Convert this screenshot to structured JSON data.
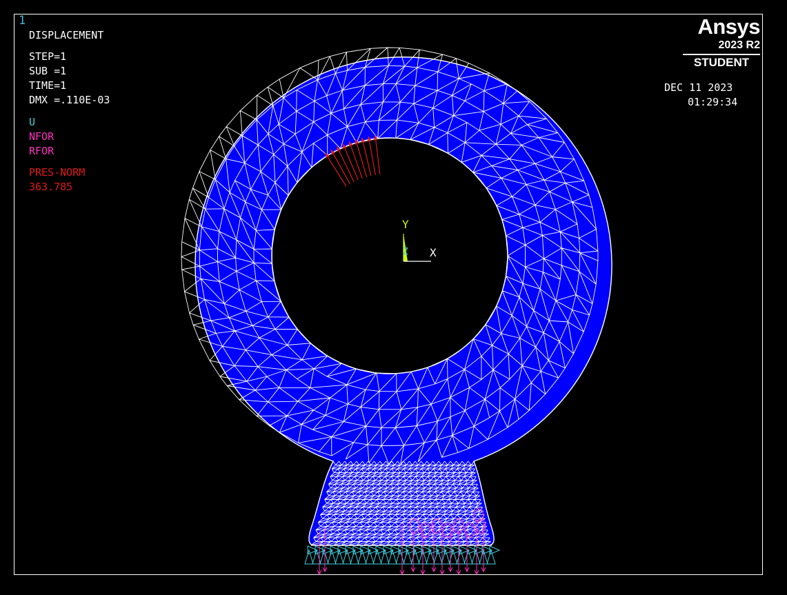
{
  "window_number": "1",
  "plot": {
    "title": "DISPLACEMENT",
    "step": "STEP=1",
    "sub": "SUB =1",
    "time": "TIME=1",
    "dmx": "DMX =.110E-03"
  },
  "legend": {
    "u": "U",
    "nfor": "NFOR",
    "rfor": "RFOR",
    "pressure_label": "PRES-NORM",
    "pressure_value": "363.785"
  },
  "branding": {
    "name": "Ansys",
    "version": "2023 R2",
    "edition": "STUDENT"
  },
  "timestamp": {
    "date": "DEC 11 2023",
    "time": "01:29:34"
  },
  "triad": {
    "x": "X",
    "y": "Y",
    "z": "Z"
  },
  "colors": {
    "background": "#000000",
    "element_fill": "#0000ff",
    "mesh_lines": "#ffffff",
    "pressure_arrows": "#e01a1a",
    "reaction_forces": "#ff30c0",
    "constraints": "#3fd0e0",
    "triad_y": "#c8ff00"
  }
}
